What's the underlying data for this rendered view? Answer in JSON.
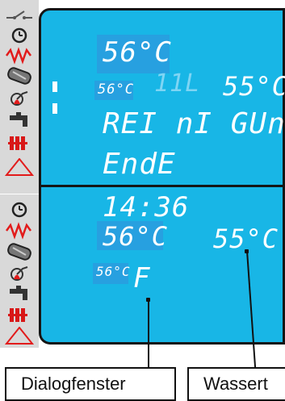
{
  "top_panel": {
    "setpoint_box": "56°C",
    "setpoint_small": "56°C",
    "temp_right": "55°C",
    "line1": "REI nI GUn",
    "line2": "EndE"
  },
  "bottom_panel": {
    "time": "14:36",
    "setpoint_box": "56°C",
    "temp_right": "55°C",
    "small_box": "56°C",
    "status": "F"
  },
  "callouts": {
    "left_label": "Dialogfenster",
    "right_label": "Wassert"
  },
  "icons_top": [
    "switch-icon",
    "clock-icon",
    "zigzag-heat-icon",
    "boiler-tank-icon",
    "burner-fan-icon",
    "tap-icon",
    "radiator-icon",
    "warning-triangle-icon"
  ],
  "icons_bottom": [
    "clock-icon",
    "zigzag-heat-icon",
    "boiler-tank-icon",
    "burner-fan-icon",
    "tap-icon",
    "radiator-icon",
    "warning-triangle-icon"
  ],
  "colors": {
    "display_blue": "#18b6e6",
    "segment_white": "#ffffff",
    "alert_red": "#e21b1b"
  }
}
